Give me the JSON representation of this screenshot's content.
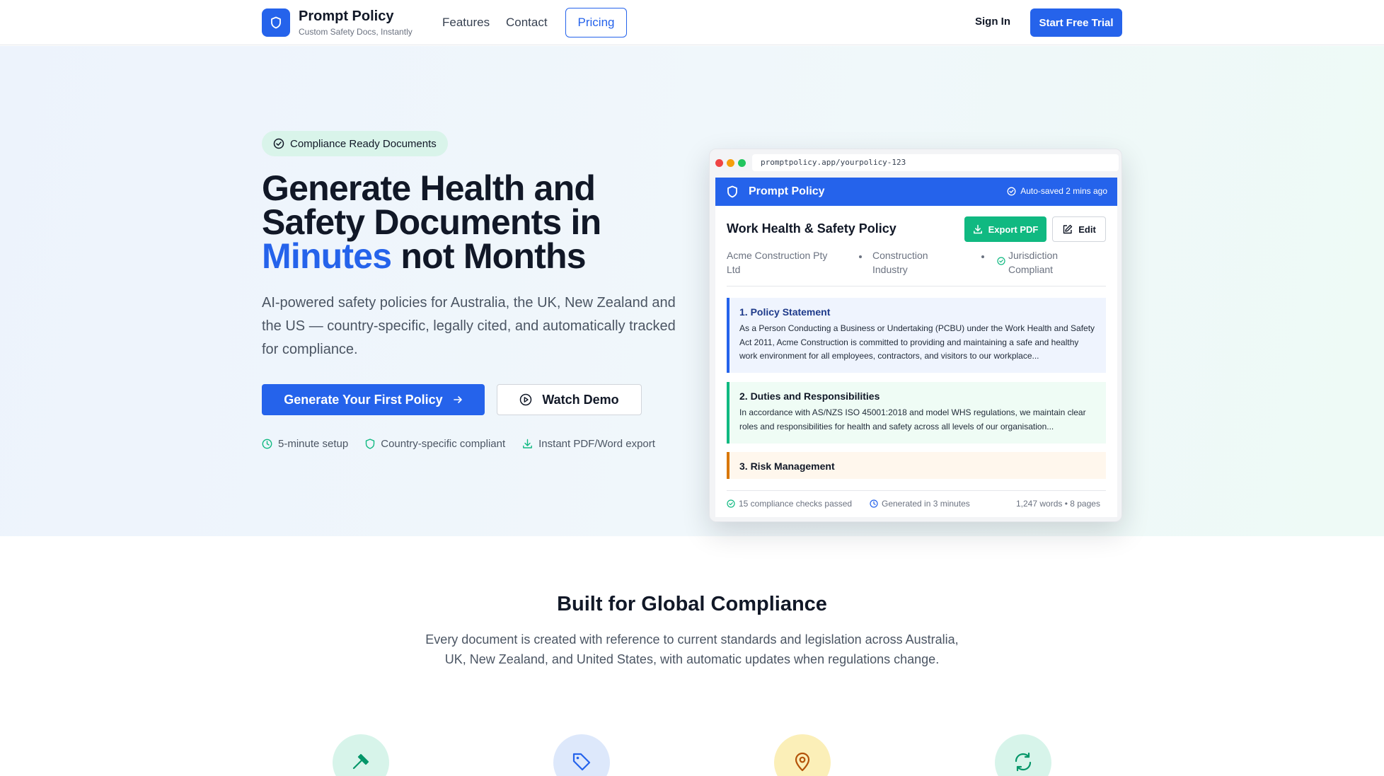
{
  "nav": {
    "brand_name": "Prompt Policy",
    "brand_tagline": "Custom Safety Docs, Instantly",
    "links": [
      "Features",
      "Contact"
    ],
    "pricing": "Pricing",
    "sign_in": "Sign In",
    "start_trial": "Start Free Trial"
  },
  "hero": {
    "badge": "Compliance Ready Documents",
    "headline_line1": "Generate Health and",
    "headline_line2": "Safety Documents in",
    "headline_highlight": "Minutes",
    "headline_rest": " not Months",
    "subtext": "AI-powered safety policies for Australia, the UK, New Zealand and the US — country-specific, legally cited, and automatically tracked for compliance.",
    "cta_primary": "Generate Your First Policy",
    "cta_demo": "Watch Demo",
    "features": [
      "5-minute setup",
      "Country-specific compliant",
      "Instant PDF/Word export"
    ]
  },
  "mockup": {
    "url": "promptpolicy.app/yourpolicy-123",
    "app_title": "Prompt Policy",
    "autosave": "Auto-saved 2 mins ago",
    "doc_title": "Work Health & Safety Policy",
    "export_label": "Export PDF",
    "edit_label": "Edit",
    "meta_company_1": "Acme Construction Pty",
    "meta_company_2": "Ltd",
    "meta_industry_1": "Construction",
    "meta_industry_2": "Industry",
    "meta_juris_1": "Jurisdiction",
    "meta_juris_2": "Compliant",
    "sections": [
      {
        "title": "1. Policy Statement",
        "body": "As a Person Conducting a Business or Undertaking (PCBU) under the Work Health and Safety Act 2011, Acme Construction is committed to providing and maintaining a safe and healthy work environment for all employees, contractors, and visitors to our workplace..."
      },
      {
        "title": "2. Duties and Responsibilities",
        "body": "In accordance with AS/NZS ISO 45001:2018 and model WHS regulations, we maintain clear roles and responsibilities for health and safety across all levels of our organisation..."
      },
      {
        "title": "3. Risk Management",
        "body": ""
      }
    ],
    "footer_checks": "15 compliance checks passed",
    "footer_generated": "Generated in 3 minutes",
    "footer_words": "1,247 words • 8 pages"
  },
  "compliance": {
    "title": "Built for Global Compliance",
    "description": "Every document is created with reference to current standards and legislation across Australia, UK, New Zealand, and United States, with automatic updates when regulations change.",
    "icons": [
      "gavel-icon",
      "tag-icon",
      "map-pin-icon",
      "refresh-icon"
    ]
  },
  "colors": {
    "primary": "#2563eb",
    "success": "#10b981",
    "warning": "#d97706"
  }
}
